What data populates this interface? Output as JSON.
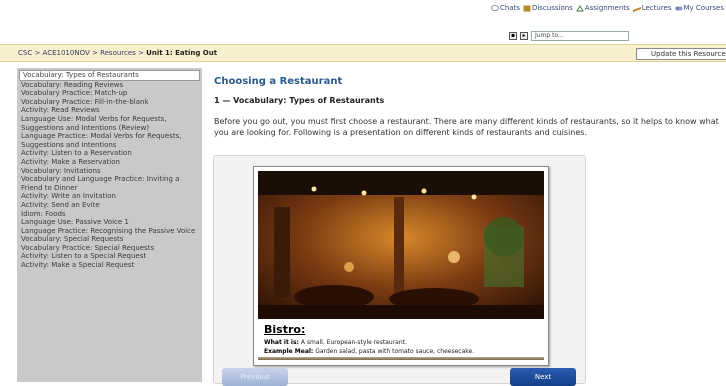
{
  "header": {
    "links": [
      {
        "label": "Chats",
        "icon": "chat-icon"
      },
      {
        "label": "Discussions",
        "icon": "discussions-icon"
      },
      {
        "label": "Assignments",
        "icon": "assignments-icon"
      },
      {
        "label": "Lectures",
        "icon": "lectures-icon"
      },
      {
        "label": "My Courses",
        "icon": "courses-icon"
      }
    ],
    "jump_placeholder": "Jump to..."
  },
  "breadcrumb": {
    "parts": [
      "CSC",
      "ACE1010NOV",
      "Resources"
    ],
    "current": "Unit 1: Eating Out"
  },
  "update_button": "Update this Resource",
  "sidebar": {
    "items": [
      "Vocabulary: Types of Restaurants",
      "Vocabulary: Reading Reviews",
      "Vocabulary Practice: Match-up",
      "Vocabulary Practice: Fill-in-the-blank",
      "Activity: Read Reviews",
      "Language Use: Modal Verbs for Requests, Suggestions and Intentions (Review)",
      "Language Practice: Modal Verbs for Requests, Suggestions and Intentions",
      "Activity: Listen to a Reservation",
      "Activity: Make a Reservation",
      "Vocabulary: Invitations",
      "Vocabulary and Language Practice: Inviting a Friend to Dinner",
      "Activity: Write an Invitation",
      "Activity: Send an Evite",
      "Idiom: Foods",
      "Language Use: Passive Voice 1",
      "Language Practice: Recognising the Passive Voice",
      "Vocabulary: Special Requests",
      "Vocabulary Practice: Special Requests",
      "Activity: Listen to a Special Request",
      "Activity: Make a Special Request"
    ],
    "active_index": 0
  },
  "main": {
    "title": "Choosing a Restaurant",
    "section_heading": "1 — Vocabulary: Types of Restaurants",
    "intro": "Before you go out, you must first choose a restaurant. There are many different kinds of restaurants, so it helps to know what you are looking for. Following is a presentation on different kinds of restaurants and cuisines."
  },
  "slide": {
    "title": "Bistro:",
    "what_label": "What it is:",
    "what_text": "A small, European-style restaurant.",
    "meal_label": "Example Meal:",
    "meal_text": "Garden salad, pasta with tomato sauce, cheesecake.",
    "prev_label": "Previous",
    "next_label": "Next"
  },
  "colors": {
    "crumb_bg": "#f8f0cc",
    "sidebar_bg": "#c9c9c9",
    "title_blue": "#2a5a8c",
    "next_button": "#1a4a9c"
  }
}
